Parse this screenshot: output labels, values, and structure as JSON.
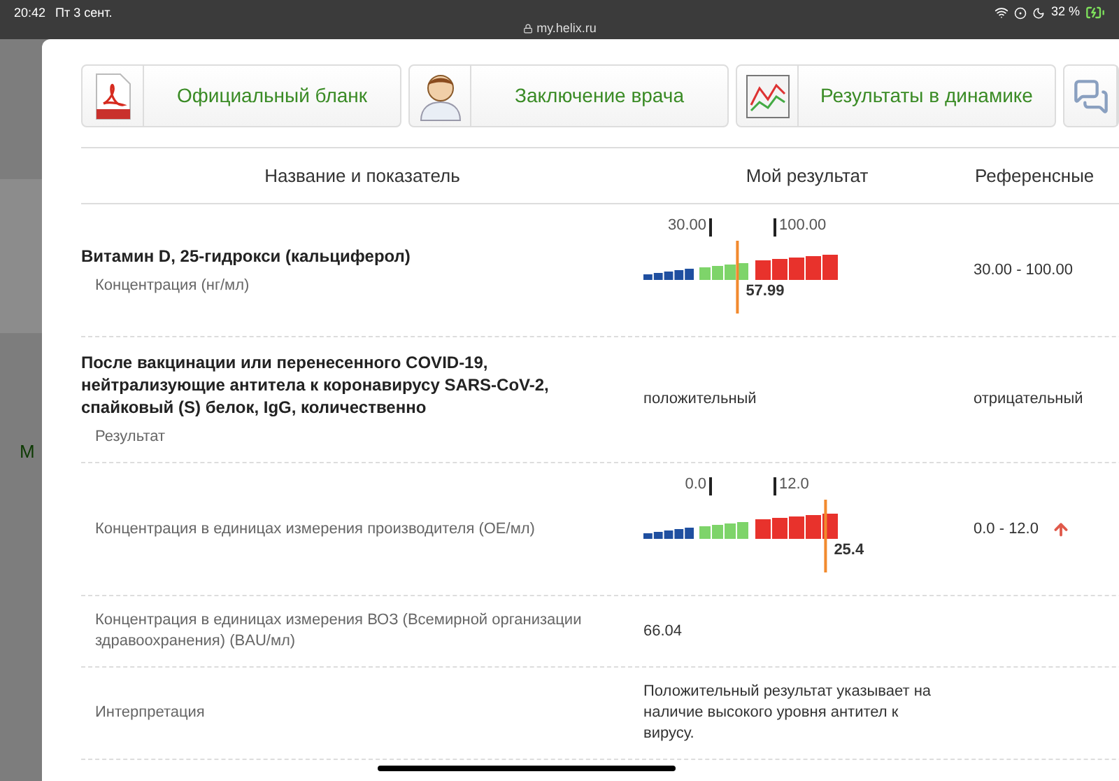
{
  "status_bar": {
    "time": "20:42",
    "date": "Пт 3 сент.",
    "url": "my.helix.ru",
    "battery": "32 %"
  },
  "background_fragment": "М",
  "toolbar": [
    {
      "kind": "pdf",
      "label": "Официальный бланк"
    },
    {
      "kind": "doctor",
      "label": "Заключение врача"
    },
    {
      "kind": "chart",
      "label": "Результаты в динамике"
    },
    {
      "kind": "help"
    }
  ],
  "table": {
    "columns": [
      "Название и показатель",
      "Мой результат",
      "Референсные"
    ],
    "rows": [
      {
        "title": "Витамин D, 25-гидрокси (кальциферол)",
        "indicator": "Концентрация (нг/мл)",
        "result": {
          "kind": "gauge",
          "low": "30.00",
          "high": "100.00",
          "value": "57.99",
          "level": 0.48
        },
        "reference": "30.00 - 100.00",
        "above_range": false
      },
      {
        "title": "После вакцинации или перенесенного COVID-19, нейтрализующие антитела к коронавирусу SARS-CoV-2, спайковый (S) белок, IgG, количественно",
        "indicator": "Результат",
        "result": {
          "kind": "text",
          "text": "положительный"
        },
        "reference": "отрицательный",
        "above_range": false
      },
      {
        "indicator": "Концентрация в единицах измерения производителя (ОЕ/мл)",
        "result": {
          "kind": "gauge",
          "low": "0.0",
          "high": "12.0",
          "value": "25.4",
          "level": 0.93
        },
        "reference": "0.0 - 12.0",
        "above_range": true
      },
      {
        "indicator": "Концентрация в единицах измерения ВОЗ (Всемирной организации здравоохранения) (BAU/мл)",
        "result": {
          "kind": "text",
          "text": "66.04"
        },
        "above_range": false
      },
      {
        "indicator": "Интерпретация",
        "result": {
          "kind": "text",
          "text": "Положительный результат указывает на наличие высокого уровня антител к вирусу."
        },
        "above_range": false
      }
    ]
  }
}
